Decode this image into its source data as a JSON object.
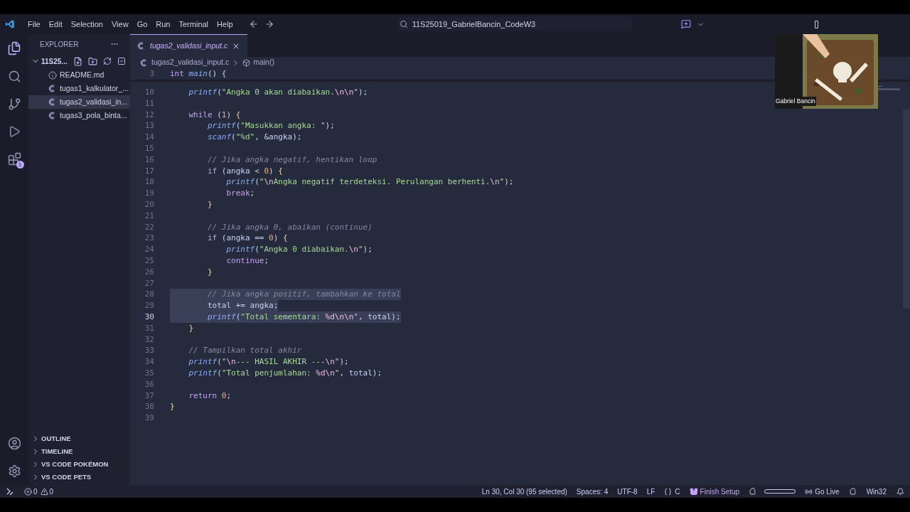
{
  "menu": [
    "File",
    "Edit",
    "Selection",
    "View",
    "Go",
    "Run",
    "Terminal",
    "Help"
  ],
  "command_center": "11S25019_GabrielBancin_CodeW3",
  "explorer": {
    "title": "EXPLORER",
    "folder": "11S25...",
    "expanded": true,
    "files": [
      {
        "name": "README.md",
        "kind": "info",
        "selected": false
      },
      {
        "name": "tugas1_kalkulator_...",
        "kind": "c",
        "selected": false
      },
      {
        "name": "tugas2_validasi_in...",
        "kind": "c",
        "selected": true
      },
      {
        "name": "tugas3_pola_binta...",
        "kind": "c",
        "selected": false
      }
    ]
  },
  "sections": [
    {
      "label": "OUTLINE",
      "expanded": false
    },
    {
      "label": "TIMELINE",
      "expanded": false
    },
    {
      "label": "VS CODE POKÉMON",
      "expanded": false
    },
    {
      "label": "VS CODE PETS",
      "expanded": false
    }
  ],
  "activity_badge": "1",
  "tabs": [
    {
      "label": "tugas2_validasi_input.c",
      "selected": true
    }
  ],
  "breadcrumbs": [
    "tugas2_validasi_input.c",
    "main()"
  ],
  "sticky": {
    "no": "3",
    "tokens": [
      {
        "kind": "kw",
        "text": "int "
      },
      {
        "kind": "fn",
        "text": "main"
      },
      {
        "kind": "p",
        "text": "() {"
      }
    ]
  },
  "lines": [
    {
      "no": "10",
      "highlighted": false,
      "current": false,
      "tokens": [
        {
          "kind": "fn",
          "text": "    printf"
        },
        {
          "kind": "p",
          "text": "("
        },
        {
          "kind": "str",
          "text": "\"Angka 0 akan diabaikan."
        },
        {
          "kind": "esc",
          "text": "\\n\\n"
        },
        {
          "kind": "str",
          "text": "\""
        },
        {
          "kind": "p",
          "text": ");"
        }
      ]
    },
    {
      "no": "11",
      "current": false
    },
    {
      "no": "12",
      "highlighted": false,
      "current": false,
      "tokens": [
        {
          "kind": "kw",
          "text": "    while"
        },
        {
          "kind": "p",
          "text": " ("
        },
        {
          "kind": "num",
          "text": "1"
        },
        {
          "kind": "p",
          "text": ") "
        },
        {
          "kind": "brace",
          "text": "{"
        }
      ]
    },
    {
      "no": "13",
      "highlighted": false,
      "current": false,
      "tokens": [
        {
          "kind": "fn",
          "text": "        printf"
        },
        {
          "kind": "p",
          "text": "("
        },
        {
          "kind": "str",
          "text": "\"Masukkan angka: \""
        },
        {
          "kind": "p",
          "text": ");"
        }
      ]
    },
    {
      "no": "14",
      "highlighted": false,
      "current": false,
      "tokens": [
        {
          "kind": "fn",
          "text": "        scanf"
        },
        {
          "kind": "p",
          "text": "("
        },
        {
          "kind": "str",
          "text": "\"%d\""
        },
        {
          "kind": "p",
          "text": ", &angka);"
        }
      ]
    },
    {
      "no": "15",
      "current": false
    },
    {
      "no": "16",
      "highlighted": false,
      "current": false,
      "tokens": [
        {
          "kind": "cmt",
          "text": "        // Jika angka negatif, hentikan loop"
        }
      ]
    },
    {
      "no": "17",
      "highlighted": false,
      "current": false,
      "tokens": [
        {
          "kind": "kw",
          "text": "        if"
        },
        {
          "kind": "p",
          "text": " (angka < "
        },
        {
          "kind": "num",
          "text": "0"
        },
        {
          "kind": "p",
          "text": ") "
        },
        {
          "kind": "brace",
          "text": "{"
        }
      ]
    },
    {
      "no": "18",
      "highlighted": false,
      "current": false,
      "tokens": [
        {
          "kind": "fn",
          "text": "            printf"
        },
        {
          "kind": "p",
          "text": "("
        },
        {
          "kind": "str",
          "text": "\""
        },
        {
          "kind": "esc",
          "text": "\\n"
        },
        {
          "kind": "str",
          "text": "Angka negatif terdeteksi. Perulangan berhenti."
        },
        {
          "kind": "esc",
          "text": "\\n"
        },
        {
          "kind": "str",
          "text": "\""
        },
        {
          "kind": "p",
          "text": ");"
        }
      ]
    },
    {
      "no": "19",
      "highlighted": false,
      "current": false,
      "tokens": [
        {
          "kind": "kw",
          "text": "            break"
        },
        {
          "kind": "p",
          "text": ";"
        }
      ]
    },
    {
      "no": "20",
      "highlighted": false,
      "current": false,
      "tokens": [
        {
          "kind": "brace",
          "text": "        }"
        }
      ]
    },
    {
      "no": "21",
      "current": false
    },
    {
      "no": "22",
      "highlighted": false,
      "current": false,
      "tokens": [
        {
          "kind": "cmt",
          "text": "        // Jika angka 0, abaikan (continue)"
        }
      ]
    },
    {
      "no": "23",
      "highlighted": false,
      "current": false,
      "tokens": [
        {
          "kind": "kw",
          "text": "        if"
        },
        {
          "kind": "p",
          "text": " (angka == "
        },
        {
          "kind": "num",
          "text": "0"
        },
        {
          "kind": "p",
          "text": ") "
        },
        {
          "kind": "brace",
          "text": "{"
        }
      ]
    },
    {
      "no": "24",
      "highlighted": false,
      "current": false,
      "tokens": [
        {
          "kind": "fn",
          "text": "            printf"
        },
        {
          "kind": "p",
          "text": "("
        },
        {
          "kind": "str",
          "text": "\"Angka 0 diabaikan."
        },
        {
          "kind": "esc",
          "text": "\\n"
        },
        {
          "kind": "str",
          "text": "\""
        },
        {
          "kind": "p",
          "text": ");"
        }
      ]
    },
    {
      "no": "25",
      "highlighted": false,
      "current": false,
      "tokens": [
        {
          "kind": "kw",
          "text": "            continue"
        },
        {
          "kind": "p",
          "text": ";"
        }
      ]
    },
    {
      "no": "26",
      "highlighted": false,
      "current": false,
      "tokens": [
        {
          "kind": "brace",
          "text": "        }"
        }
      ]
    },
    {
      "no": "27",
      "current": false
    },
    {
      "no": "28",
      "highlighted": true,
      "current": false,
      "tokens": [
        {
          "kind": "cmt",
          "text": "        // Jika angka positif, tambahkan ke total"
        }
      ]
    },
    {
      "no": "29",
      "highlighted": true,
      "current": false,
      "tokens": [
        {
          "kind": "p",
          "text": "        total += angka;"
        }
      ]
    },
    {
      "no": "30",
      "highlighted": true,
      "current": true,
      "tokens": [
        {
          "kind": "fn",
          "text": "        printf"
        },
        {
          "kind": "p",
          "text": "("
        },
        {
          "kind": "str",
          "text": "\"Total sementara: "
        },
        {
          "kind": "esc",
          "text": "%d\\n\\n"
        },
        {
          "kind": "str",
          "text": "\""
        },
        {
          "kind": "p",
          "text": ", total);"
        }
      ]
    },
    {
      "no": "31",
      "highlighted": false,
      "current": false,
      "tokens": [
        {
          "kind": "brace",
          "text": "    }"
        }
      ]
    },
    {
      "no": "32",
      "current": false
    },
    {
      "no": "33",
      "highlighted": false,
      "current": false,
      "tokens": [
        {
          "kind": "cmt",
          "text": "    // Tampilkan total akhir"
        }
      ]
    },
    {
      "no": "34",
      "highlighted": false,
      "current": false,
      "tokens": [
        {
          "kind": "fn",
          "text": "    printf"
        },
        {
          "kind": "p",
          "text": "("
        },
        {
          "kind": "str",
          "text": "\""
        },
        {
          "kind": "esc",
          "text": "\\n"
        },
        {
          "kind": "str",
          "text": "--- HASIL AKHIR ---"
        },
        {
          "kind": "esc",
          "text": "\\n"
        },
        {
          "kind": "str",
          "text": "\""
        },
        {
          "kind": "p",
          "text": ");"
        }
      ]
    },
    {
      "no": "35",
      "highlighted": false,
      "current": false,
      "tokens": [
        {
          "kind": "fn",
          "text": "    printf"
        },
        {
          "kind": "p",
          "text": "("
        },
        {
          "kind": "str",
          "text": "\"Total penjumlahan: "
        },
        {
          "kind": "esc",
          "text": "%d\\n"
        },
        {
          "kind": "str",
          "text": "\""
        },
        {
          "kind": "p",
          "text": ", total);"
        }
      ]
    },
    {
      "no": "36",
      "current": false
    },
    {
      "no": "37",
      "highlighted": false,
      "current": false,
      "tokens": [
        {
          "kind": "kw",
          "text": "    return "
        },
        {
          "kind": "num",
          "text": "0"
        },
        {
          "kind": "p",
          "text": ";"
        }
      ]
    },
    {
      "no": "38",
      "highlighted": false,
      "current": false,
      "tokens": [
        {
          "kind": "brace",
          "text": "}"
        }
      ]
    },
    {
      "no": "39",
      "current": false
    }
  ],
  "webcam": {
    "name": "Gabriel Bancin"
  },
  "status": {
    "errors": "0",
    "warnings": "0",
    "position": "Ln 30, Col 30 (95 selected)",
    "spaces": "Spaces: 4",
    "encoding": "UTF-8",
    "eol": "LF",
    "language": "C",
    "setup": "Finish Setup",
    "live": "Go Live",
    "platform": "Win32"
  }
}
